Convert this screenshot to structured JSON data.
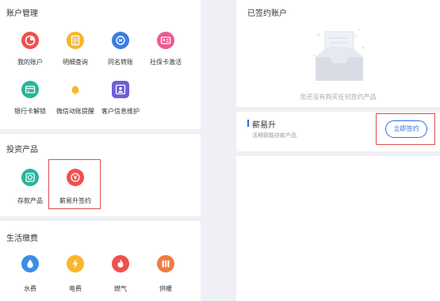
{
  "account_section": {
    "title": "账户管理",
    "items": [
      {
        "label": "我的账户",
        "icon": "pie-chart-icon",
        "color": "#f0504f"
      },
      {
        "label": "明细查询",
        "icon": "document-list-icon",
        "color": "#f7b62c"
      },
      {
        "label": "同名转账",
        "icon": "transfer-icon",
        "color": "#3a7de0"
      },
      {
        "label": "社保卡激活",
        "icon": "id-card-icon",
        "color": "#ee5a8f"
      },
      {
        "label": "银行卡解锁",
        "icon": "bank-card-icon",
        "color": "#27b59a"
      },
      {
        "label": "微信动账提醒",
        "icon": "bell-icon",
        "color": "#f7b62c"
      },
      {
        "label": "客户信息维护",
        "icon": "user-profile-icon",
        "color": "#6c5fd6"
      }
    ]
  },
  "investment_section": {
    "title": "投资产品",
    "items": [
      {
        "label": "存款产品",
        "icon": "deposit-icon",
        "color": "#27b59a"
      },
      {
        "label": "薪易升签约",
        "icon": "yuan-coin-icon",
        "color": "#f0504f"
      }
    ]
  },
  "living_section": {
    "title": "生活缴费",
    "items": [
      {
        "label": "水费",
        "icon": "water-drop-icon",
        "color": "#3a8ee6"
      },
      {
        "label": "电费",
        "icon": "lightning-icon",
        "color": "#f7b62c"
      },
      {
        "label": "燃气",
        "icon": "flame-icon",
        "color": "#f0504f"
      },
      {
        "label": "供暖",
        "icon": "radiator-icon",
        "color": "#f07b3f"
      }
    ]
  },
  "signed_accounts": {
    "title": "已签约账户",
    "empty_text": "您还没有购买任何签约产品"
  },
  "product": {
    "name": "薪易升",
    "description": "活期智能存款产品",
    "sign_button": "立即签约"
  }
}
